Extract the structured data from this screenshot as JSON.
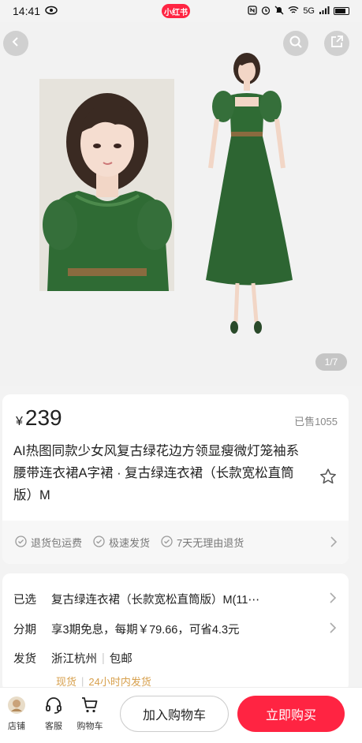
{
  "status_bar": {
    "time": "14:41",
    "app_badge": "小红书",
    "network": "5G"
  },
  "gallery": {
    "counter": "1/7"
  },
  "product": {
    "currency": "¥",
    "price": "239",
    "sold": "已售1055",
    "title": "AI热图同款少女风复古绿花边方领显瘦微灯笼袖系腰带连衣裙A字裙 · 复古绿连衣裙（长款宽松直筒版）M",
    "guarantees": [
      "退货包运费",
      "极速发货",
      "7天无理由退货"
    ]
  },
  "details": {
    "selected_label": "已选",
    "selected_value": "复古绿连衣裙（长款宽松直筒版）M(11⋯",
    "installment_label": "分期",
    "installment_value": "享3期免息，每期￥79.66，可省4.3元",
    "shipping_label": "发货",
    "shipping_from": "浙江杭州",
    "shipping_free": "包邮",
    "stock_label": "现货",
    "ship_time": "24小时内发货"
  },
  "bottom_bar": {
    "shop_label": "店铺",
    "service_label": "客服",
    "cart_label": "购物车",
    "add_to_cart": "加入购物车",
    "buy_now": "立即购买"
  },
  "colors": {
    "accent": "#ff2442",
    "dress_green": "#2f6b34",
    "hint_gold": "#d7a04d"
  }
}
